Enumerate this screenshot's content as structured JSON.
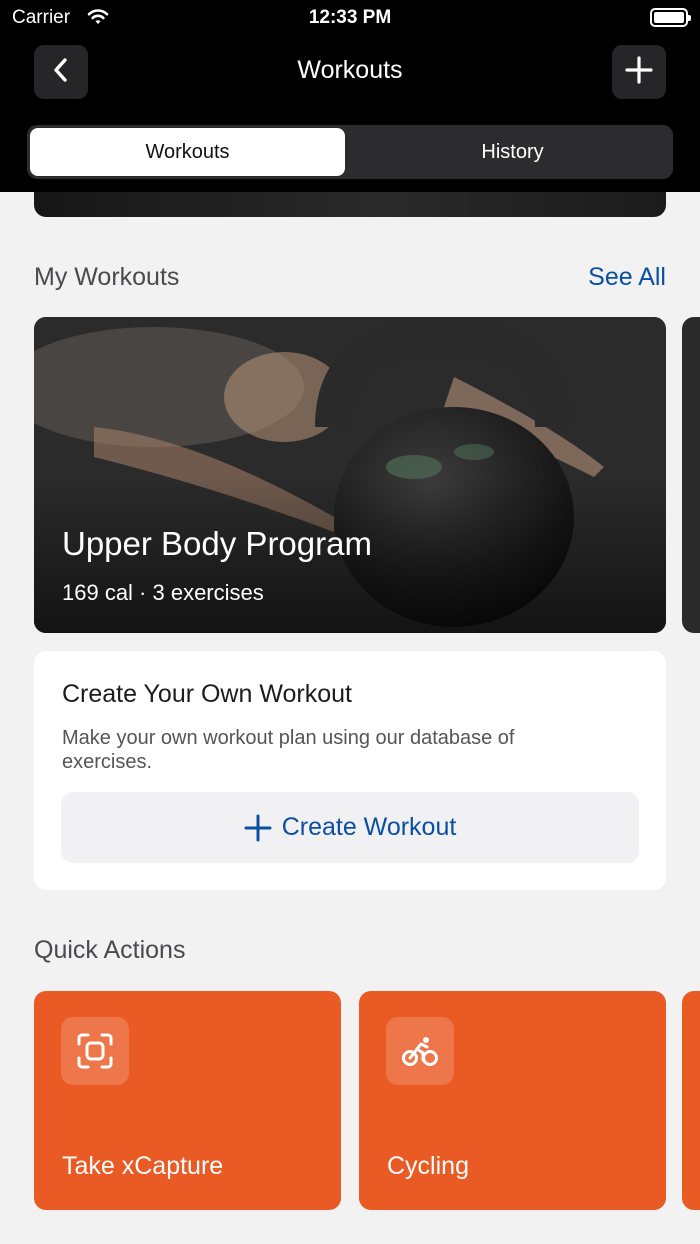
{
  "status_bar": {
    "carrier": "Carrier",
    "time": "12:33 PM"
  },
  "header": {
    "title": "Workouts",
    "back_icon": "chevron-left-icon",
    "add_icon": "plus-icon"
  },
  "segments": [
    {
      "label": "Workouts",
      "selected": true
    },
    {
      "label": "History",
      "selected": false
    }
  ],
  "my_workouts": {
    "title": "My Workouts",
    "see_all": "See All",
    "card": {
      "title": "Upper Body Program",
      "meta": "169 cal · 3 exercises"
    }
  },
  "create": {
    "title": "Create Your Own Workout",
    "description": "Make your own workout plan using our database of exercises.",
    "button_label": "Create Workout"
  },
  "quick_actions": {
    "title": "Quick Actions",
    "items": [
      {
        "label": "Take xCapture",
        "icon": "scan-icon"
      },
      {
        "label": "Cycling",
        "icon": "bicycle-icon"
      }
    ],
    "accent": "#e95a24"
  },
  "colors": {
    "link": "#0b4fa3",
    "header_bg": "#000000",
    "page_bg": "#f2f2f3"
  }
}
